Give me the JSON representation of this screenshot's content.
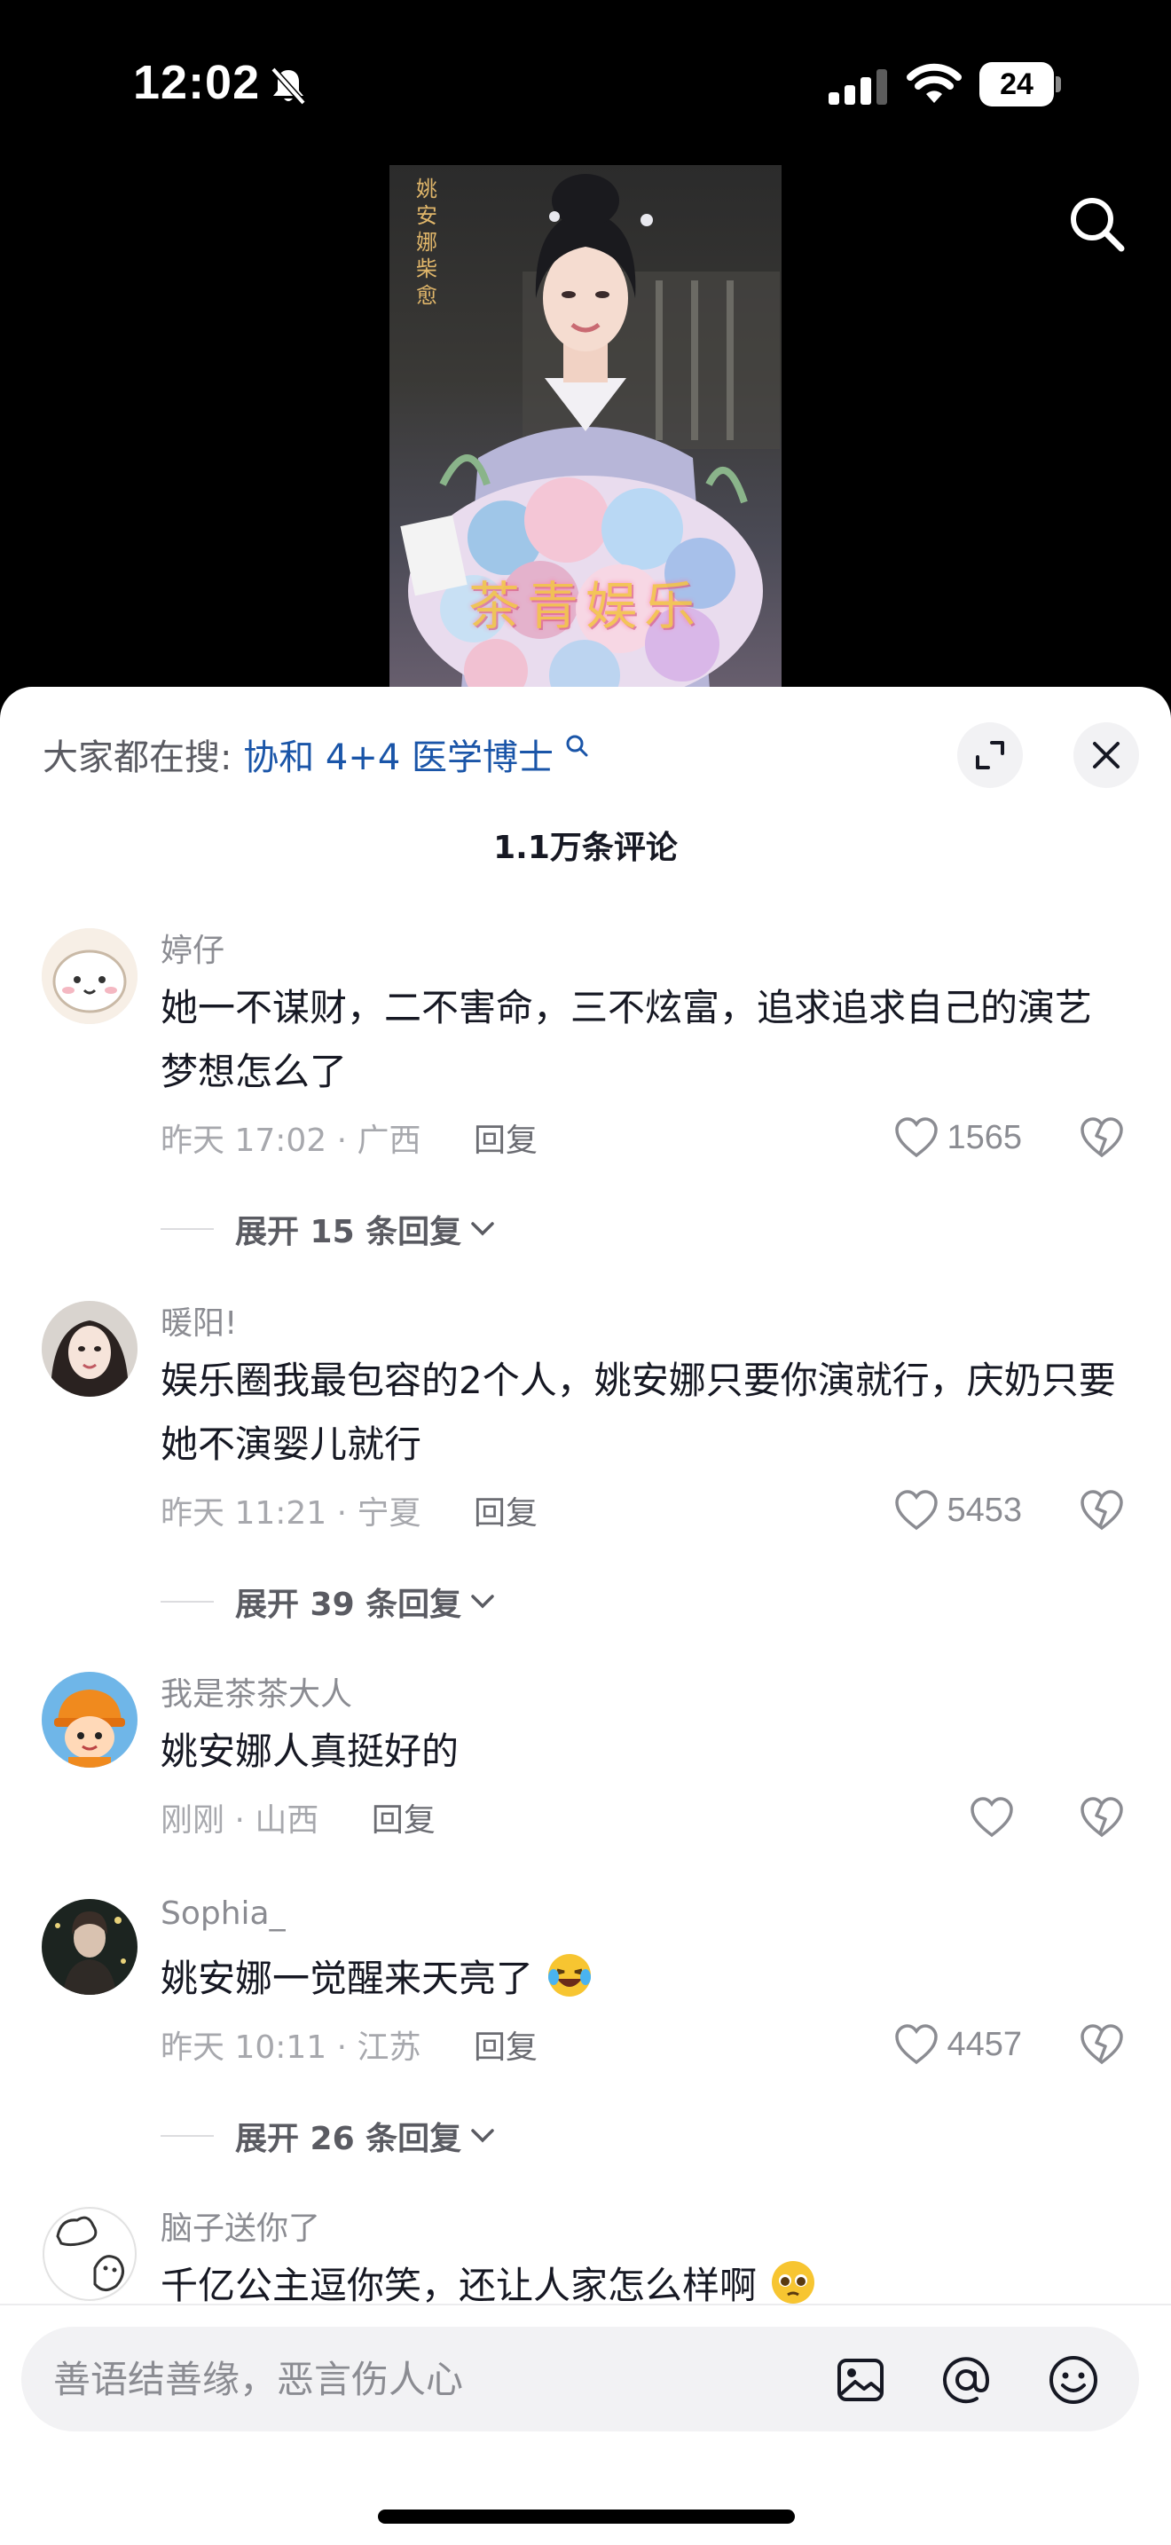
{
  "status_bar": {
    "time": "12:02",
    "battery": "24"
  },
  "video": {
    "vertical_caption": "姚安娜 柴愈",
    "watermark": "茶青娱乐"
  },
  "comments_panel": {
    "trending_label": "大家都在搜:",
    "trending_topic": "协和 4+4 医学博士",
    "count_label": "1.1万条评论",
    "comments": [
      {
        "user": "婷仔",
        "text": "她一不谋财，二不害命，三不炫富，追求追求自己的演艺梦想怎么了",
        "time": "昨天 17:02",
        "location": "广西",
        "reply_label": "回复",
        "likes": "1565",
        "expand_label": "展开 15 条回复"
      },
      {
        "user": "暖阳!",
        "text": "娱乐圈我最包容的2个人，姚安娜只要你演就行，庆奶只要她不演婴儿就行",
        "time": "昨天 11:21",
        "location": "宁夏",
        "reply_label": "回复",
        "likes": "5453",
        "expand_label": "展开 39 条回复"
      },
      {
        "user": "我是茶茶大人",
        "text": "姚安娜人真挺好的",
        "time": "刚刚",
        "location": "山西",
        "reply_label": "回复",
        "likes": ""
      },
      {
        "user": "Sophia_",
        "text": "姚安娜一觉醒来天亮了",
        "time": "昨天 10:11",
        "location": "江苏",
        "reply_label": "回复",
        "likes": "4457",
        "expand_label": "展开 26 条回复"
      },
      {
        "user": "脑子送你了",
        "text": "千亿公主逗你笑，还让人家怎么样啊"
      }
    ]
  },
  "input_bar": {
    "placeholder": "善语结善缘，恶言伤人心"
  },
  "colors": {
    "topic_link": "#1a55a8",
    "text_primary": "#161823",
    "text_secondary": "#8b8c92"
  }
}
